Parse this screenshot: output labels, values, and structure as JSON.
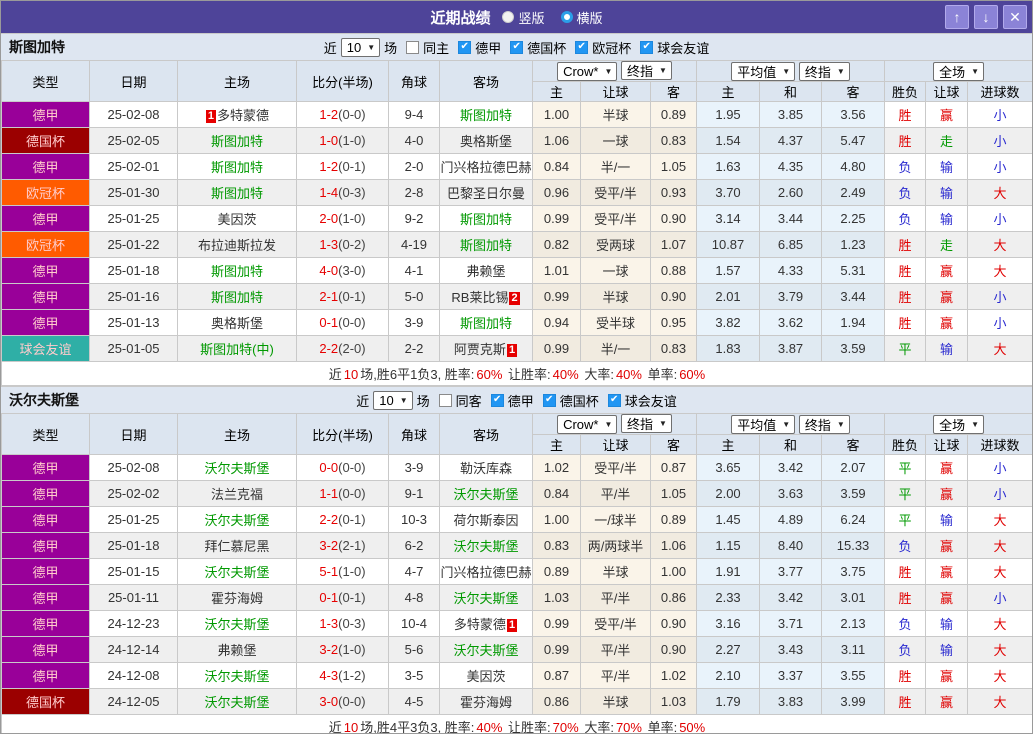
{
  "icons": {
    "up": "↑",
    "down": "↓",
    "close": "✕",
    "caret": "▼",
    "check": "✔"
  },
  "title_bar": {
    "title": "近期战绩",
    "radios": [
      {
        "label": "竖版",
        "checked": false
      },
      {
        "label": "横版",
        "checked": true
      }
    ]
  },
  "filter_common": {
    "prefix": "近",
    "count": "10",
    "suffix": "场"
  },
  "header": {
    "type": "类型",
    "date": "日期",
    "home": "主场",
    "score": "比分(半场)",
    "corner": "角球",
    "away": "客场",
    "crow_select": "Crow*",
    "final_select": "终指",
    "avg_select": "平均值",
    "final_select2": "终指",
    "scope_select": "全场",
    "sub": {
      "h": "主",
      "handicap": "让球",
      "a": "客",
      "avg_h": "主",
      "avg_d": "和",
      "avg_a": "客",
      "wdl": "胜负",
      "handicap2": "让球",
      "goals": "进球数"
    }
  },
  "league_colors": {
    "德甲": "#990099",
    "德国杯": "#9B0000",
    "欧冠杯": "#FF5B00",
    "球会友谊": "#2FAFA6"
  },
  "outcome_colors": {
    "胜": "#E00000",
    "负": "#2A2AD0",
    "平": "#009900",
    "赢": "#E00000",
    "输": "#2A2AD0",
    "走": "#009900",
    "大": "#E00000",
    "小": "#2A2AD0"
  },
  "sections": [
    {
      "team": "斯图加特",
      "filters": {
        "same_label": "同主",
        "same_checked": false,
        "leagues": [
          {
            "label": "德甲",
            "checked": true
          },
          {
            "label": "德国杯",
            "checked": true
          },
          {
            "label": "欧冠杯",
            "checked": true
          },
          {
            "label": "球会友谊",
            "checked": true
          }
        ]
      },
      "rows": [
        {
          "league": "德甲",
          "date": "25-02-08",
          "home": {
            "name": "多特蒙德",
            "self": false,
            "badge_pre": "1"
          },
          "score": "1-2",
          "half": "(0-0)",
          "corners": "9-4",
          "away": {
            "name": "斯图加特",
            "self": true
          },
          "odds": [
            "1.00",
            "半球",
            "0.89"
          ],
          "avg": [
            "1.95",
            "3.85",
            "3.56"
          ],
          "results": [
            "胜",
            "赢",
            "小"
          ]
        },
        {
          "league": "德国杯",
          "date": "25-02-05",
          "home": {
            "name": "斯图加特",
            "self": true
          },
          "score": "1-0",
          "half": "(1-0)",
          "corners": "4-0",
          "away": {
            "name": "奥格斯堡",
            "self": false
          },
          "odds": [
            "1.06",
            "一球",
            "0.83"
          ],
          "avg": [
            "1.54",
            "4.37",
            "5.47"
          ],
          "results": [
            "胜",
            "走",
            "小"
          ]
        },
        {
          "league": "德甲",
          "date": "25-02-01",
          "home": {
            "name": "斯图加特",
            "self": true
          },
          "score": "1-2",
          "half": "(0-1)",
          "corners": "2-0",
          "away": {
            "name": "门兴格拉德巴赫",
            "self": false
          },
          "odds": [
            "0.84",
            "半/一",
            "1.05"
          ],
          "avg": [
            "1.63",
            "4.35",
            "4.80"
          ],
          "results": [
            "负",
            "输",
            "小"
          ]
        },
        {
          "league": "欧冠杯",
          "date": "25-01-30",
          "home": {
            "name": "斯图加特",
            "self": true
          },
          "score": "1-4",
          "half": "(0-3)",
          "corners": "2-8",
          "away": {
            "name": "巴黎圣日尔曼",
            "self": false
          },
          "odds": [
            "0.96",
            "受平/半",
            "0.93"
          ],
          "avg": [
            "3.70",
            "2.60",
            "2.49"
          ],
          "results": [
            "负",
            "输",
            "大"
          ]
        },
        {
          "league": "德甲",
          "date": "25-01-25",
          "home": {
            "name": "美因茨",
            "self": false
          },
          "score": "2-0",
          "half": "(1-0)",
          "corners": "9-2",
          "away": {
            "name": "斯图加特",
            "self": true
          },
          "odds": [
            "0.99",
            "受平/半",
            "0.90"
          ],
          "avg": [
            "3.14",
            "3.44",
            "2.25"
          ],
          "results": [
            "负",
            "输",
            "小"
          ]
        },
        {
          "league": "欧冠杯",
          "date": "25-01-22",
          "home": {
            "name": "布拉迪斯拉发",
            "self": false
          },
          "score": "1-3",
          "half": "(0-2)",
          "corners": "4-19",
          "away": {
            "name": "斯图加特",
            "self": true
          },
          "odds": [
            "0.82",
            "受两球",
            "1.07"
          ],
          "avg": [
            "10.87",
            "6.85",
            "1.23"
          ],
          "results": [
            "胜",
            "走",
            "大"
          ]
        },
        {
          "league": "德甲",
          "date": "25-01-18",
          "home": {
            "name": "斯图加特",
            "self": true
          },
          "score": "4-0",
          "half": "(3-0)",
          "corners": "4-1",
          "away": {
            "name": "弗赖堡",
            "self": false
          },
          "odds": [
            "1.01",
            "一球",
            "0.88"
          ],
          "avg": [
            "1.57",
            "4.33",
            "5.31"
          ],
          "results": [
            "胜",
            "赢",
            "大"
          ]
        },
        {
          "league": "德甲",
          "date": "25-01-16",
          "home": {
            "name": "斯图加特",
            "self": true
          },
          "score": "2-1",
          "half": "(0-1)",
          "corners": "5-0",
          "away": {
            "name": "RB莱比锡",
            "self": false,
            "badge_post": "2"
          },
          "odds": [
            "0.99",
            "半球",
            "0.90"
          ],
          "avg": [
            "2.01",
            "3.79",
            "3.44"
          ],
          "results": [
            "胜",
            "赢",
            "小"
          ]
        },
        {
          "league": "德甲",
          "date": "25-01-13",
          "home": {
            "name": "奥格斯堡",
            "self": false
          },
          "score": "0-1",
          "half": "(0-0)",
          "corners": "3-9",
          "away": {
            "name": "斯图加特",
            "self": true
          },
          "odds": [
            "0.94",
            "受半球",
            "0.95"
          ],
          "avg": [
            "3.82",
            "3.62",
            "1.94"
          ],
          "results": [
            "胜",
            "赢",
            "小"
          ]
        },
        {
          "league": "球会友谊",
          "date": "25-01-05",
          "home": {
            "name": "斯图加特(中)",
            "self": true
          },
          "score": "2-2",
          "half": "(2-0)",
          "corners": "2-2",
          "away": {
            "name": "阿贾克斯",
            "self": false,
            "badge_post": "1"
          },
          "odds": [
            "0.99",
            "半/一",
            "0.83"
          ],
          "avg": [
            "1.83",
            "3.87",
            "3.59"
          ],
          "results": [
            "平",
            "输",
            "大"
          ]
        }
      ],
      "summary": [
        {
          "text": "近",
          "color": "#333333"
        },
        {
          "text": "10",
          "color": "#E00000"
        },
        {
          "text": "场,胜6平1负3, 胜率:",
          "color": "#333333"
        },
        {
          "text": "60%",
          "color": "#E00000"
        },
        {
          "text": " 让胜率:",
          "color": "#333333"
        },
        {
          "text": "40%",
          "color": "#E00000"
        },
        {
          "text": " 大率:",
          "color": "#333333"
        },
        {
          "text": "40%",
          "color": "#E00000"
        },
        {
          "text": " 单率:",
          "color": "#333333"
        },
        {
          "text": "60%",
          "color": "#E00000"
        }
      ]
    },
    {
      "team": "沃尔夫斯堡",
      "filters": {
        "same_label": "同客",
        "same_checked": false,
        "leagues": [
          {
            "label": "德甲",
            "checked": true
          },
          {
            "label": "德国杯",
            "checked": true
          },
          {
            "label": "球会友谊",
            "checked": true
          }
        ]
      },
      "rows": [
        {
          "league": "德甲",
          "date": "25-02-08",
          "home": {
            "name": "沃尔夫斯堡",
            "self": true
          },
          "score": "0-0",
          "half": "(0-0)",
          "corners": "3-9",
          "away": {
            "name": "勒沃库森",
            "self": false
          },
          "odds": [
            "1.02",
            "受平/半",
            "0.87"
          ],
          "avg": [
            "3.65",
            "3.42",
            "2.07"
          ],
          "results": [
            "平",
            "赢",
            "小"
          ]
        },
        {
          "league": "德甲",
          "date": "25-02-02",
          "home": {
            "name": "法兰克福",
            "self": false
          },
          "score": "1-1",
          "half": "(0-0)",
          "corners": "9-1",
          "away": {
            "name": "沃尔夫斯堡",
            "self": true
          },
          "odds": [
            "0.84",
            "平/半",
            "1.05"
          ],
          "avg": [
            "2.00",
            "3.63",
            "3.59"
          ],
          "results": [
            "平",
            "赢",
            "小"
          ]
        },
        {
          "league": "德甲",
          "date": "25-01-25",
          "home": {
            "name": "沃尔夫斯堡",
            "self": true
          },
          "score": "2-2",
          "half": "(0-1)",
          "corners": "10-3",
          "away": {
            "name": "荷尔斯泰因",
            "self": false
          },
          "odds": [
            "1.00",
            "一/球半",
            "0.89"
          ],
          "avg": [
            "1.45",
            "4.89",
            "6.24"
          ],
          "results": [
            "平",
            "输",
            "大"
          ]
        },
        {
          "league": "德甲",
          "date": "25-01-18",
          "home": {
            "name": "拜仁慕尼黑",
            "self": false
          },
          "score": "3-2",
          "half": "(2-1)",
          "corners": "6-2",
          "away": {
            "name": "沃尔夫斯堡",
            "self": true
          },
          "odds": [
            "0.83",
            "两/两球半",
            "1.06"
          ],
          "avg": [
            "1.15",
            "8.40",
            "15.33"
          ],
          "results": [
            "负",
            "赢",
            "大"
          ]
        },
        {
          "league": "德甲",
          "date": "25-01-15",
          "home": {
            "name": "沃尔夫斯堡",
            "self": true
          },
          "score": "5-1",
          "half": "(1-0)",
          "corners": "4-7",
          "away": {
            "name": "门兴格拉德巴赫",
            "self": false
          },
          "odds": [
            "0.89",
            "半球",
            "1.00"
          ],
          "avg": [
            "1.91",
            "3.77",
            "3.75"
          ],
          "results": [
            "胜",
            "赢",
            "大"
          ]
        },
        {
          "league": "德甲",
          "date": "25-01-11",
          "home": {
            "name": "霍芬海姆",
            "self": false
          },
          "score": "0-1",
          "half": "(0-1)",
          "corners": "4-8",
          "away": {
            "name": "沃尔夫斯堡",
            "self": true
          },
          "odds": [
            "1.03",
            "平/半",
            "0.86"
          ],
          "avg": [
            "2.33",
            "3.42",
            "3.01"
          ],
          "results": [
            "胜",
            "赢",
            "小"
          ]
        },
        {
          "league": "德甲",
          "date": "24-12-23",
          "home": {
            "name": "沃尔夫斯堡",
            "self": true
          },
          "score": "1-3",
          "half": "(0-3)",
          "corners": "10-4",
          "away": {
            "name": "多特蒙德",
            "self": false,
            "badge_post": "1"
          },
          "odds": [
            "0.99",
            "受平/半",
            "0.90"
          ],
          "avg": [
            "3.16",
            "3.71",
            "2.13"
          ],
          "results": [
            "负",
            "输",
            "大"
          ]
        },
        {
          "league": "德甲",
          "date": "24-12-14",
          "home": {
            "name": "弗赖堡",
            "self": false
          },
          "score": "3-2",
          "half": "(1-0)",
          "corners": "5-6",
          "away": {
            "name": "沃尔夫斯堡",
            "self": true
          },
          "odds": [
            "0.99",
            "平/半",
            "0.90"
          ],
          "avg": [
            "2.27",
            "3.43",
            "3.11"
          ],
          "results": [
            "负",
            "输",
            "大"
          ]
        },
        {
          "league": "德甲",
          "date": "24-12-08",
          "home": {
            "name": "沃尔夫斯堡",
            "self": true
          },
          "score": "4-3",
          "half": "(1-2)",
          "corners": "3-5",
          "away": {
            "name": "美因茨",
            "self": false
          },
          "odds": [
            "0.87",
            "平/半",
            "1.02"
          ],
          "avg": [
            "2.10",
            "3.37",
            "3.55"
          ],
          "results": [
            "胜",
            "赢",
            "大"
          ]
        },
        {
          "league": "德国杯",
          "date": "24-12-05",
          "home": {
            "name": "沃尔夫斯堡",
            "self": true
          },
          "score": "3-0",
          "half": "(0-0)",
          "corners": "4-5",
          "away": {
            "name": "霍芬海姆",
            "self": false
          },
          "odds": [
            "0.86",
            "半球",
            "1.03"
          ],
          "avg": [
            "1.79",
            "3.83",
            "3.99"
          ],
          "results": [
            "胜",
            "赢",
            "大"
          ]
        }
      ],
      "summary": [
        {
          "text": "近",
          "color": "#333333"
        },
        {
          "text": "10",
          "color": "#E00000"
        },
        {
          "text": "场,胜4平3负3, 胜率:",
          "color": "#333333"
        },
        {
          "text": "40%",
          "color": "#E00000"
        },
        {
          "text": " 让胜率:",
          "color": "#333333"
        },
        {
          "text": "70%",
          "color": "#E00000"
        },
        {
          "text": " 大率:",
          "color": "#333333"
        },
        {
          "text": "70%",
          "color": "#E00000"
        },
        {
          "text": " 单率:",
          "color": "#333333"
        },
        {
          "text": "50%",
          "color": "#E00000"
        }
      ]
    }
  ]
}
